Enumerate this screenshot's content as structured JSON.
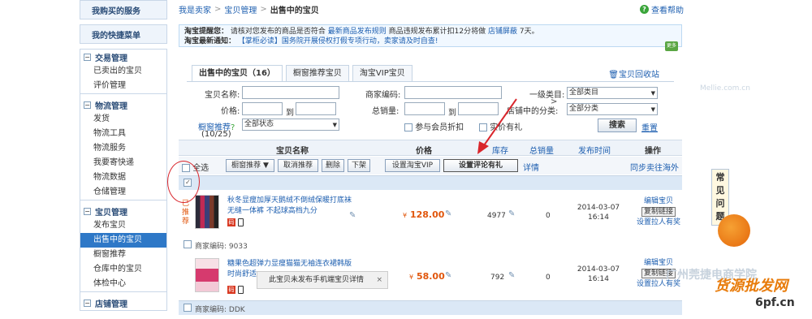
{
  "sidebar": {
    "boxes": [
      "我购买的服务",
      "我的快捷菜单"
    ],
    "arrow": ">",
    "sections": [
      {
        "title": "交易管理",
        "items": [
          "已卖出的宝贝",
          "评价管理"
        ]
      },
      {
        "title": "物流管理",
        "items": [
          "发货",
          "物流工具",
          "物流服务",
          "我要寄快递",
          "物流数据",
          "仓储管理"
        ]
      },
      {
        "title": "宝贝管理",
        "items": [
          "发布宝贝",
          "出售中的宝贝",
          "橱窗推荐",
          "仓库中的宝贝",
          "体检中心"
        ]
      },
      {
        "title": "店铺管理",
        "items": []
      }
    ],
    "active_item": "出售中的宝贝"
  },
  "breadcrumb": {
    "items": [
      "我是卖家",
      "宝贝管理"
    ],
    "current": "出售中的宝贝",
    "sep": ">"
  },
  "help": {
    "label": "查看帮助",
    "icon": "?"
  },
  "notice": {
    "line1_label": "淘宝提醒您：",
    "line1_text": "请核对您发布的商品是否符合",
    "line1_link1": "最新商品发布规则",
    "line1_text2": "商品违规发布累计扣12分将做",
    "line1_link2": "店铺屏蔽",
    "line1_text3": "7天。",
    "line2_label": "淘宝最新通知：",
    "line2_text": "【掌柜必读】国务院开展侵权打假专项行动，卖家请及时自查!",
    "badge": "更多"
  },
  "tabs": [
    "出售中的宝贝（16）",
    "橱窗推荐宝贝",
    "淘宝VIP宝贝"
  ],
  "recycle": "宝贝回收站",
  "filters": {
    "name_label": "宝贝名称:",
    "code_label": "商家编码:",
    "cat_label": "一级类目:",
    "cat_value": "全部类目",
    "price_label": "价格:",
    "to": "到",
    "sales_label": "总销量:",
    "shop_cat_label": "店铺中的分类:",
    "shop_cat_value": "全部分类",
    "showcase_label": "橱窗推荐",
    "showcase_count": "(10/25)",
    "status_value": "全部状态",
    "opt1": "参与会员折扣",
    "opt2": "实价有礼",
    "search": "搜索",
    "reset": "重置"
  },
  "table": {
    "headers": {
      "name": "宝贝名称",
      "price": "价格",
      "stock": "库存",
      "sales": "总销量",
      "time": "发布时间",
      "ops": "操作"
    },
    "actions": [
      "全选",
      "橱窗推荐",
      "取消推荐",
      "删除",
      "下架",
      "设置淘宝VIP",
      "设置评论有礼"
    ],
    "detail": "详情",
    "sync": "同步卖往海外",
    "recommended": "已推荐",
    "rows": [
      {
        "title": "秋冬显瘦加厚天鹅绒不倒绒保暖打底袜 无缝一体裤 不起球高档九分",
        "price": "128.00",
        "currency": "¥",
        "stock": "4977",
        "sales": "0",
        "date": "2014-03-07",
        "time": "16:14",
        "edit": "编辑宝贝",
        "copy": "复制链接",
        "promo": "设置拉人有奖",
        "code_label": "商家编码:",
        "code": "9033"
      },
      {
        "title": "糖果色超弹力显瘦猫猫无袖连衣裙韩版 时尚舒适",
        "price": "58.00",
        "currency": "¥",
        "stock": "792",
        "sales": "0",
        "date": "2014-03-07",
        "time": "16:14",
        "edit": "编辑宝贝",
        "copy": "复制链接",
        "promo": "设置拉人有奖",
        "code_label": "商家编码:",
        "code": "DDK"
      }
    ],
    "tag_label": "码"
  },
  "tooltip": {
    "text": "此宝贝未发布手机端宝贝详情",
    "close": "×"
  },
  "faq": "常见问题",
  "watermarks": {
    "w1": "广州莞捷电商学院",
    "w2": "货源批发网",
    "w3": "6pf.cn",
    "w4": "Mellie.com.cn"
  }
}
